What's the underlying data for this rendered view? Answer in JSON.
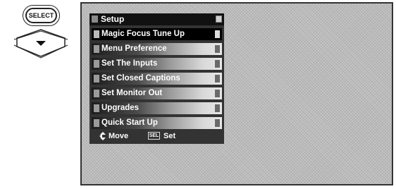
{
  "remote": {
    "select_label": "SELECT"
  },
  "menu": {
    "title": "Setup",
    "items": [
      {
        "label": "Magic Focus Tune Up"
      },
      {
        "label": "Menu Preference"
      },
      {
        "label": "Set The Inputs"
      },
      {
        "label": "Set Closed Captions"
      },
      {
        "label": "Set Monitor Out"
      },
      {
        "label": "Upgrades"
      },
      {
        "label": "Quick Start Up"
      }
    ],
    "selected_index": 0,
    "footer": {
      "move_label": "Move",
      "sel_key_label": "SEL",
      "set_label": "Set"
    }
  }
}
